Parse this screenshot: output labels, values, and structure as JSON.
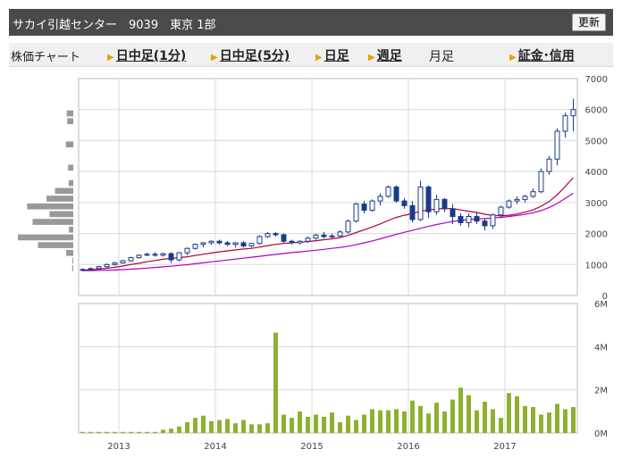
{
  "header": {
    "title": "サカイ引越センター　9039　東京 1部",
    "refresh_label": "更新"
  },
  "nav": {
    "chart_label": "株価チャート",
    "links": [
      "日中足(1分)",
      "日中足(5分)",
      "日足",
      "週足"
    ],
    "current": "月足",
    "credit_link": "証金･信用"
  },
  "colors": {
    "up_candle": "#ffffff",
    "down_candle": "#1a3a8a",
    "candle_outline": "#1a3a8a",
    "ma_short": "#b0003a",
    "ma_long": "#b000c0",
    "volume_bar": "#8db030",
    "volume_profile": "#999999",
    "grid": "#d8d8d8"
  },
  "chart_data": [
    {
      "type": "candlestick",
      "title": "",
      "y_ticks": [
        "0",
        "1000",
        "2000",
        "3000",
        "4000",
        "5000",
        "6000",
        "7000"
      ],
      "ylim": [
        0,
        7000
      ],
      "x_ticks": [
        "2013",
        "2014",
        "2015",
        "2016",
        "2017"
      ],
      "ohlc": [
        [
          820,
          880,
          780,
          840
        ],
        [
          840,
          900,
          800,
          870
        ],
        [
          870,
          960,
          850,
          930
        ],
        [
          930,
          1030,
          900,
          1000
        ],
        [
          1000,
          1080,
          960,
          1050
        ],
        [
          1050,
          1150,
          1020,
          1120
        ],
        [
          1120,
          1250,
          1100,
          1220
        ],
        [
          1220,
          1330,
          1190,
          1300
        ],
        [
          1300,
          1380,
          1280,
          1330
        ],
        [
          1330,
          1400,
          1250,
          1300
        ],
        [
          1300,
          1380,
          1260,
          1350
        ],
        [
          1350,
          1400,
          1050,
          1150
        ],
        [
          1150,
          1400,
          1100,
          1380
        ],
        [
          1380,
          1550,
          1300,
          1520
        ],
        [
          1520,
          1680,
          1480,
          1650
        ],
        [
          1650,
          1720,
          1550,
          1700
        ],
        [
          1700,
          1780,
          1640,
          1750
        ],
        [
          1750,
          1800,
          1640,
          1700
        ],
        [
          1700,
          1760,
          1600,
          1650
        ],
        [
          1650,
          1720,
          1550,
          1700
        ],
        [
          1700,
          1760,
          1550,
          1600
        ],
        [
          1600,
          1700,
          1550,
          1680
        ],
        [
          1680,
          1950,
          1650,
          1900
        ],
        [
          1900,
          2050,
          1850,
          2000
        ],
        [
          2000,
          2050,
          1900,
          1960
        ],
        [
          1960,
          2000,
          1700,
          1750
        ],
        [
          1750,
          1800,
          1650,
          1700
        ],
        [
          1700,
          1780,
          1650,
          1750
        ],
        [
          1750,
          1900,
          1700,
          1850
        ],
        [
          1850,
          2000,
          1800,
          1950
        ],
        [
          1950,
          2050,
          1850,
          1900
        ],
        [
          1900,
          2000,
          1850,
          1920
        ],
        [
          1920,
          2100,
          1900,
          2050
        ],
        [
          2050,
          2450,
          2000,
          2400
        ],
        [
          2400,
          3000,
          2350,
          2950
        ],
        [
          2950,
          3050,
          2650,
          2750
        ],
        [
          2750,
          3100,
          2700,
          3050
        ],
        [
          3050,
          3300,
          2900,
          3200
        ],
        [
          3200,
          3550,
          3150,
          3500
        ],
        [
          3500,
          3550,
          3000,
          3050
        ],
        [
          3050,
          3150,
          2800,
          2900
        ],
        [
          2900,
          3050,
          2350,
          2450
        ],
        [
          2450,
          3700,
          2400,
          3500
        ],
        [
          3500,
          3550,
          2500,
          2700
        ],
        [
          2700,
          3250,
          2600,
          3100
        ],
        [
          3100,
          3150,
          2700,
          2800
        ],
        [
          2800,
          2950,
          2300,
          2550
        ],
        [
          2550,
          2650,
          2250,
          2350
        ],
        [
          2350,
          2650,
          2200,
          2550
        ],
        [
          2550,
          2700,
          2300,
          2400
        ],
        [
          2400,
          2500,
          2100,
          2250
        ],
        [
          2250,
          2650,
          2150,
          2600
        ],
        [
          2600,
          2900,
          2500,
          2850
        ],
        [
          2850,
          3100,
          2800,
          3050
        ],
        [
          3050,
          3200,
          2950,
          3100
        ],
        [
          3100,
          3250,
          3000,
          3200
        ],
        [
          3200,
          3450,
          3150,
          3350
        ],
        [
          3350,
          4100,
          3300,
          4000
        ],
        [
          4000,
          4500,
          3900,
          4400
        ],
        [
          4400,
          5400,
          4200,
          5300
        ],
        [
          5300,
          5900,
          5100,
          5800
        ],
        [
          5800,
          6350,
          5300,
          6000
        ]
      ],
      "ma_short": [
        820,
        830,
        850,
        880,
        910,
        950,
        1000,
        1040,
        1090,
        1130,
        1170,
        1200,
        1220,
        1250,
        1290,
        1330,
        1370,
        1410,
        1440,
        1470,
        1500,
        1520,
        1560,
        1610,
        1650,
        1680,
        1700,
        1720,
        1740,
        1770,
        1800,
        1830,
        1870,
        1940,
        2030,
        2120,
        2210,
        2310,
        2420,
        2520,
        2590,
        2640,
        2720,
        2760,
        2790,
        2810,
        2800,
        2760,
        2720,
        2680,
        2620,
        2580,
        2570,
        2590,
        2630,
        2690,
        2760,
        2880,
        3030,
        3250,
        3520,
        3800
      ],
      "ma_long": [
        800,
        805,
        810,
        815,
        825,
        835,
        850,
        865,
        885,
        905,
        925,
        945,
        970,
        995,
        1025,
        1055,
        1085,
        1115,
        1145,
        1175,
        1205,
        1235,
        1265,
        1295,
        1325,
        1355,
        1385,
        1410,
        1435,
        1460,
        1490,
        1520,
        1550,
        1590,
        1640,
        1700,
        1760,
        1830,
        1900,
        1970,
        2040,
        2100,
        2170,
        2230,
        2290,
        2340,
        2390,
        2420,
        2450,
        2470,
        2480,
        2500,
        2520,
        2550,
        2580,
        2620,
        2670,
        2740,
        2840,
        2970,
        3130,
        3300
      ]
    },
    {
      "type": "bar",
      "title": "",
      "y_ticks": [
        "0M",
        "2M",
        "4M",
        "6M"
      ],
      "ylim": [
        0,
        6
      ],
      "unit": "M",
      "values": [
        0.05,
        0.05,
        0.05,
        0.05,
        0.05,
        0.05,
        0.05,
        0.05,
        0.05,
        0.05,
        0.15,
        0.2,
        0.3,
        0.5,
        0.7,
        0.8,
        0.55,
        0.6,
        0.65,
        0.45,
        0.6,
        0.4,
        0.4,
        0.45,
        4.65,
        0.85,
        0.7,
        1.0,
        0.75,
        0.85,
        0.75,
        0.95,
        0.5,
        0.8,
        0.6,
        0.85,
        1.1,
        1.05,
        1.05,
        1.1,
        1.0,
        1.5,
        1.25,
        0.9,
        1.4,
        1.0,
        1.55,
        2.1,
        1.75,
        1.05,
        1.45,
        1.1,
        0.7,
        1.85,
        1.7,
        1.25,
        1.2,
        0.85,
        0.95,
        1.35,
        1.1,
        1.2
      ]
    }
  ]
}
